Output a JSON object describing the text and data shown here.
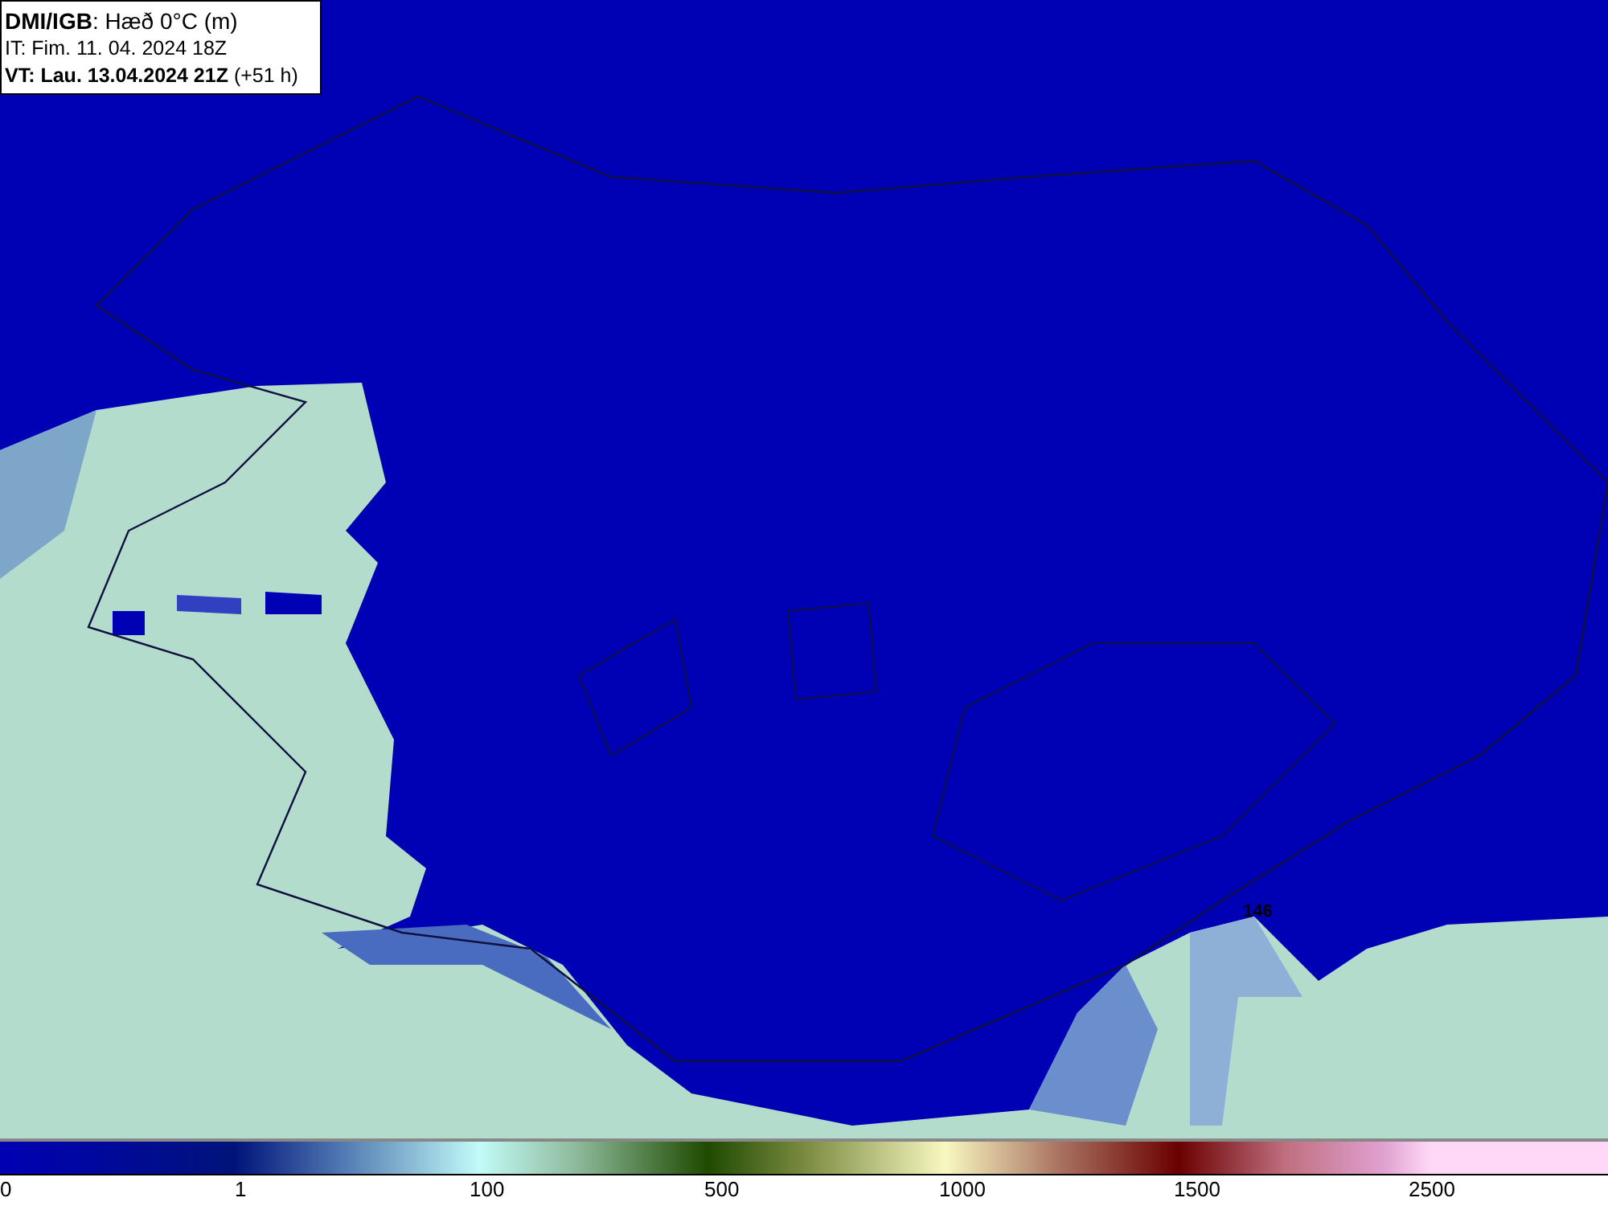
{
  "header": {
    "lines": [
      "**DMI/IGB**: Hæð 0°C (m)",
      "IT: Fim. 11. 04. 2024 18Z",
      "**VT: Lau. 13.04.2024 21Z** (+51 h)"
    ]
  },
  "map": {
    "labels": [
      "146"
    ]
  },
  "legend": {
    "ticks": [
      "0",
      "1",
      "100",
      "500",
      "1000",
      "1500",
      "2500"
    ]
  }
}
